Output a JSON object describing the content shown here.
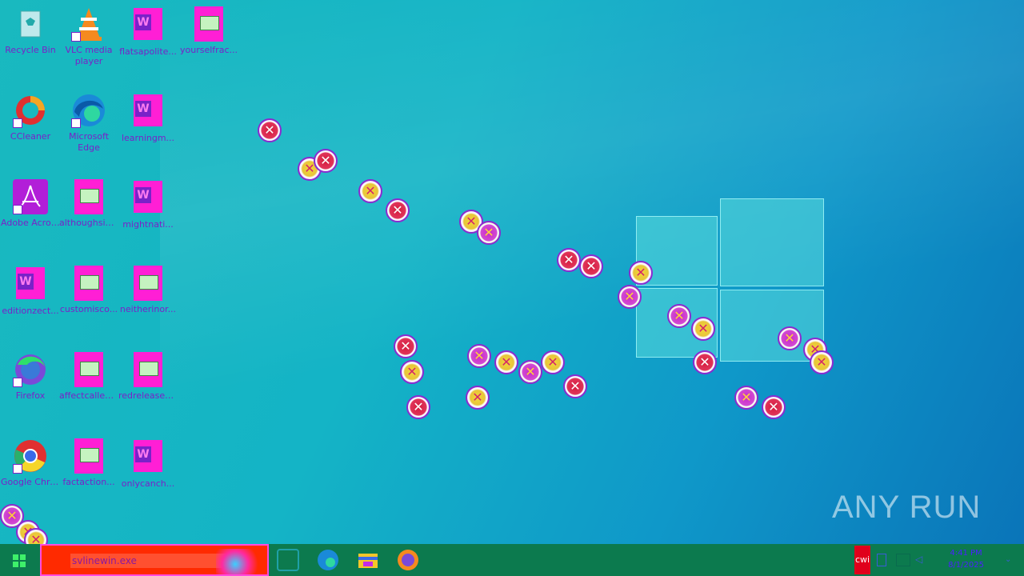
{
  "desktop": {
    "icons": [
      {
        "label": "Recycle Bin",
        "name": "recycle-bin"
      },
      {
        "label": "VLC media player",
        "name": "vlc-media-player"
      },
      {
        "label": "flatsapolite...",
        "name": "flatsapolite-doc"
      },
      {
        "label": "yourselfrac...",
        "name": "yourselfrac-image"
      },
      {
        "label": "CCleaner",
        "name": "ccleaner"
      },
      {
        "label": "Microsoft Edge",
        "name": "microsoft-edge"
      },
      {
        "label": "learningm...",
        "name": "learningm-doc"
      },
      {
        "label": "Adobe Acrobat",
        "name": "adobe-acrobat"
      },
      {
        "label": "althoughsin...",
        "name": "althoughsin-image"
      },
      {
        "label": "mightnati...",
        "name": "mightnati-doc"
      },
      {
        "label": "editionzect...",
        "name": "editionzect-doc"
      },
      {
        "label": "customisco...",
        "name": "customisco-image"
      },
      {
        "label": "neitherinor...",
        "name": "neitherinor-image"
      },
      {
        "label": "Firefox",
        "name": "firefox"
      },
      {
        "label": "affectcalled...",
        "name": "affectcalled-image"
      },
      {
        "label": "redreleasec...",
        "name": "redreleasec-image"
      },
      {
        "label": "Google Chrome",
        "name": "google-chrome"
      },
      {
        "label": "factaction...",
        "name": "factaction-image"
      },
      {
        "label": "onlycanch...",
        "name": "onlycanch-doc"
      }
    ]
  },
  "watermark": "ANY RUN",
  "taskbar": {
    "search_value": "svlinewin.exe",
    "icons": [
      "task-view-icon",
      "edge-icon",
      "file-explorer-icon",
      "firefox-icon"
    ],
    "lang": "cwi",
    "time": "4:41 PM",
    "date": "8/1/2025"
  },
  "colors": {
    "error_red": "#d41b3d",
    "icon_text": "#7a22c8",
    "taskbar": "#0c7a4e"
  }
}
